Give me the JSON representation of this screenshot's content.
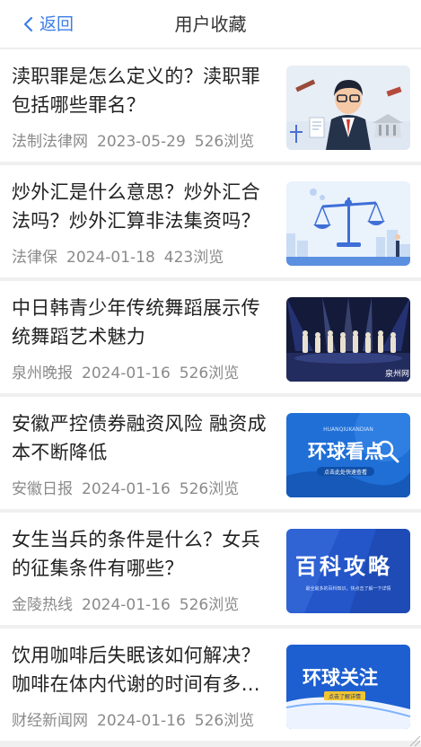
{
  "header": {
    "back_label": "返回",
    "title": "用户收藏"
  },
  "items": [
    {
      "title": "渎职罪是怎么定义的？渎职罪包括哪些罪名？",
      "source": "法制法律网",
      "date": "2023-05-29",
      "views": "526浏览",
      "thumb_icon": "lawyer-illustration"
    },
    {
      "title": "炒外汇是什么意思？炒外汇合法吗？炒外汇算非法集资吗？",
      "source": "法律保",
      "date": "2024-01-18",
      "views": "423浏览",
      "thumb_icon": "scales-illustration"
    },
    {
      "title": "中日韩青少年传统舞蹈展示传统舞蹈艺术魅力",
      "source": "泉州晚报",
      "date": "2024-01-16",
      "views": "526浏览",
      "thumb_icon": "stage-photo",
      "thumb_text": "泉州网"
    },
    {
      "title": "安徽严控债券融资风险 融资成本不断降低",
      "source": "安徽日报",
      "date": "2024-01-16",
      "views": "526浏览",
      "thumb_icon": "banner-global-view",
      "thumb_text": "环球看点",
      "thumb_small": "HUANQIUKANDIAN",
      "thumb_sub": "点击此处快速查看"
    },
    {
      "title": "女生当兵的条件是什么？女兵的征集条件有哪些？",
      "source": "金陵热线",
      "date": "2024-01-16",
      "views": "526浏览",
      "thumb_icon": "banner-encyclopedia",
      "thumb_text": "百科攻略",
      "thumb_sub": "最全最多的百科知识，快点击了解一下详情"
    },
    {
      "title": "饮用咖啡后失眠该如何解决？咖啡在体内代谢的时间有多长？",
      "source": "财经新闻网",
      "date": "2024-01-16",
      "views": "526浏览",
      "thumb_icon": "banner-global-focus",
      "thumb_text": "环球关注",
      "thumb_sub": "点击了解详情"
    }
  ],
  "colors": {
    "accent": "#3b7ee8",
    "meta_text": "#8a8a8a",
    "title_text": "#222222"
  }
}
